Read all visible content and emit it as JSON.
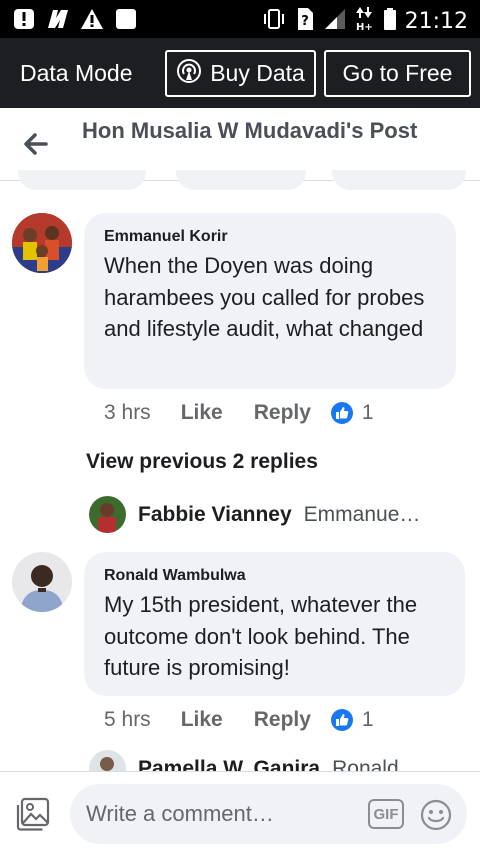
{
  "status_bar": {
    "time": "21:12"
  },
  "data_bar": {
    "mode_label": "Data Mode",
    "buy_label": "Buy Data",
    "free_label": "Go to Free"
  },
  "header": {
    "title": "Hon Musalia W Mudavadi's Post"
  },
  "comments": [
    {
      "author": "Emmanuel Korir",
      "text": "When the Doyen was doing harambees you called for probes and lifestyle audit, what changed",
      "time": "3 hrs",
      "like": "Like",
      "reply": "Reply",
      "reactions": "1"
    },
    {
      "author": "Ronald Wambulwa",
      "text": "My 15th president, whatever the outcome don't look behind. The future is promising!",
      "time": "5 hrs",
      "like": "Like",
      "reply": "Reply",
      "reactions": "1"
    }
  ],
  "view_previous": "View previous 2 replies",
  "replies": [
    {
      "author": "Fabbie Vianney",
      "snippet": "Emmanue…"
    },
    {
      "author": "Pamella W. Ganira",
      "snippet": "Ronald"
    }
  ],
  "composer": {
    "placeholder": "Write a comment…",
    "gif_label": "GIF"
  },
  "colors": {
    "statusbar": "#000000",
    "databar": "#1c1e21",
    "bubble": "#f0f2f5",
    "like_blue": "#1877f2"
  }
}
